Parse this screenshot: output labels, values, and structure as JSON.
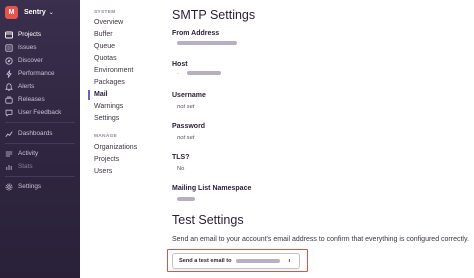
{
  "org": {
    "initial": "M",
    "name": "Sentry",
    "chevron": "⌄"
  },
  "sidebar": {
    "items": [
      {
        "label": "Projects",
        "icon": "projects-icon"
      },
      {
        "label": "Issues",
        "icon": "issues-icon"
      },
      {
        "label": "Discover",
        "icon": "discover-icon"
      },
      {
        "label": "Performance",
        "icon": "performance-icon"
      },
      {
        "label": "Alerts",
        "icon": "alerts-icon"
      },
      {
        "label": "Releases",
        "icon": "releases-icon"
      },
      {
        "label": "User Feedback",
        "icon": "user-feedback-icon"
      },
      {
        "label": "Dashboards",
        "icon": "dashboards-icon"
      },
      {
        "label": "Activity",
        "icon": "activity-icon"
      },
      {
        "label": "Stats",
        "icon": "stats-icon"
      },
      {
        "label": "Settings",
        "icon": "settings-icon"
      }
    ]
  },
  "subnav": {
    "system_heading": "SYSTEM",
    "system_links": [
      "Overview",
      "Buffer",
      "Queue",
      "Quotas",
      "Environment",
      "Packages",
      "Mail",
      "Warnings",
      "Settings"
    ],
    "manage_heading": "MANAGE",
    "manage_links": [
      "Organizations",
      "Projects",
      "Users"
    ]
  },
  "smtp": {
    "title": "SMTP Settings",
    "from_label": "From Address",
    "host_label": "Host",
    "host_value": "·",
    "username_label": "Username",
    "username_value": "not set",
    "password_label": "Password",
    "password_value": "not set",
    "tls_label": "TLS?",
    "tls_value": "No",
    "mailing_label": "Mailing List Namespace"
  },
  "test": {
    "title": "Test Settings",
    "description": "Send an email to your account's email address to confirm that everything is configured correctly.",
    "button_label": "Send a test email to",
    "button_suffix": "ı"
  },
  "colors": {
    "accent": "#6c5fc7",
    "highlight": "#e0513f",
    "sidebar": "#2f2540",
    "avatar": "#e2564d"
  }
}
